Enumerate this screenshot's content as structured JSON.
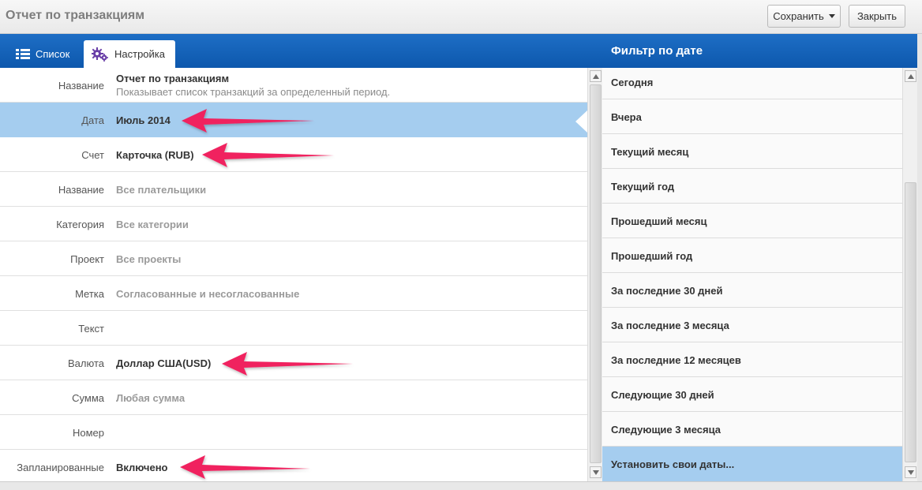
{
  "window": {
    "title": "Отчет по транзакциям"
  },
  "toolbar": {
    "save_label": "Сохранить",
    "close_label": "Закрыть"
  },
  "tabs": [
    {
      "label": "Список",
      "icon": "list-icon",
      "active": false
    },
    {
      "label": "Настройка",
      "icon": "gear-icon",
      "active": true
    }
  ],
  "settings": {
    "rows": [
      {
        "label": "Название",
        "value": "Отчет по транзакциям",
        "description": "Показывает список транзакций за определенный период.",
        "style": "dark"
      },
      {
        "label": "Дата",
        "value": "Июль 2014",
        "style": "dark",
        "selected": true
      },
      {
        "label": "Счет",
        "value": "Карточка (RUB)",
        "style": "dark"
      },
      {
        "label": "Название",
        "value": "Все плательщики",
        "style": "dim"
      },
      {
        "label": "Категория",
        "value": "Все категории",
        "style": "dim"
      },
      {
        "label": "Проект",
        "value": "Все проекты",
        "style": "dim"
      },
      {
        "label": "Метка",
        "value": "Согласованные и несогласованные",
        "style": "dim"
      },
      {
        "label": "Текст",
        "value": "",
        "style": "dim"
      },
      {
        "label": "Валюта",
        "value": "Доллар США(USD)",
        "style": "dark"
      },
      {
        "label": "Сумма",
        "value": "Любая сумма",
        "style": "dim"
      },
      {
        "label": "Номер",
        "value": "",
        "style": "dim"
      },
      {
        "label": "Запланированные",
        "value": "Включено",
        "style": "dark"
      }
    ]
  },
  "date_filter": {
    "title": "Фильтр по дате",
    "options": [
      "Сегодня",
      "Вчера",
      "Текущий месяц",
      "Текущий год",
      "Прошедший месяц",
      "Прошедший год",
      "За последние 30 дней",
      "За последние 3 месяца",
      "За последние 12 месяцев",
      "Следующие 30 дней",
      "Следующие 3 месяца",
      "Установить свои даты..."
    ],
    "selected": "Установить свои даты..."
  },
  "colors": {
    "header_blue": "#1565c0",
    "selection": "#a5cdef",
    "annotation_arrow": "#f0245e"
  }
}
